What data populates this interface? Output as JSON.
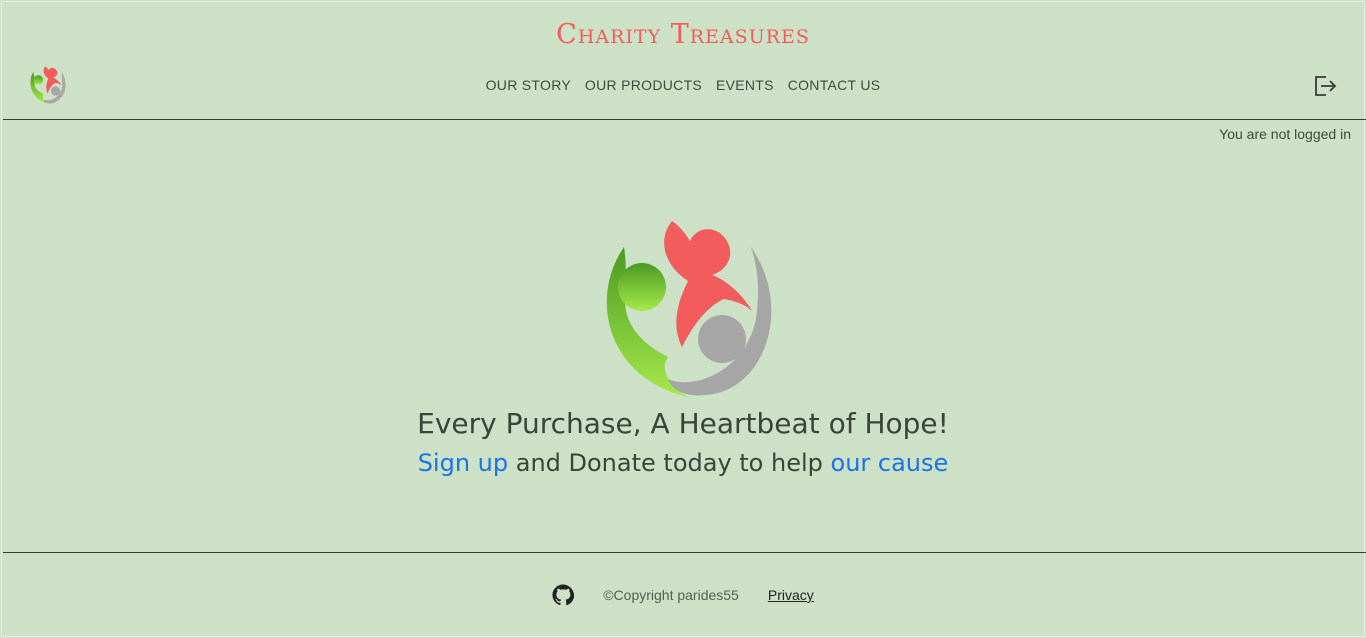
{
  "header": {
    "site_title": "Charity Treasures",
    "nav": [
      {
        "label": "OUR STORY"
      },
      {
        "label": "OUR PRODUCTS"
      },
      {
        "label": "EVENTS"
      },
      {
        "label": "CONTACT US"
      }
    ],
    "logout_icon": "logout-icon",
    "logo_icon": "charity-logo-icon"
  },
  "status": {
    "login_text": "You are not logged in"
  },
  "hero": {
    "tagline": "Every Purchase, A Heartbeat of Hope!",
    "cta_link1": "Sign up",
    "cta_middle": " and Donate today to help ",
    "cta_link2": "our cause"
  },
  "footer": {
    "github_icon": "github-icon",
    "copyright": "©Copyright parides55",
    "privacy": "Privacy"
  },
  "colors": {
    "background": "#cde1c7",
    "title": "#f25c5c",
    "link": "#1a73e8",
    "logo_green": "#6cc22e",
    "logo_red": "#f25c5c",
    "logo_gray": "#a6a6a6"
  }
}
